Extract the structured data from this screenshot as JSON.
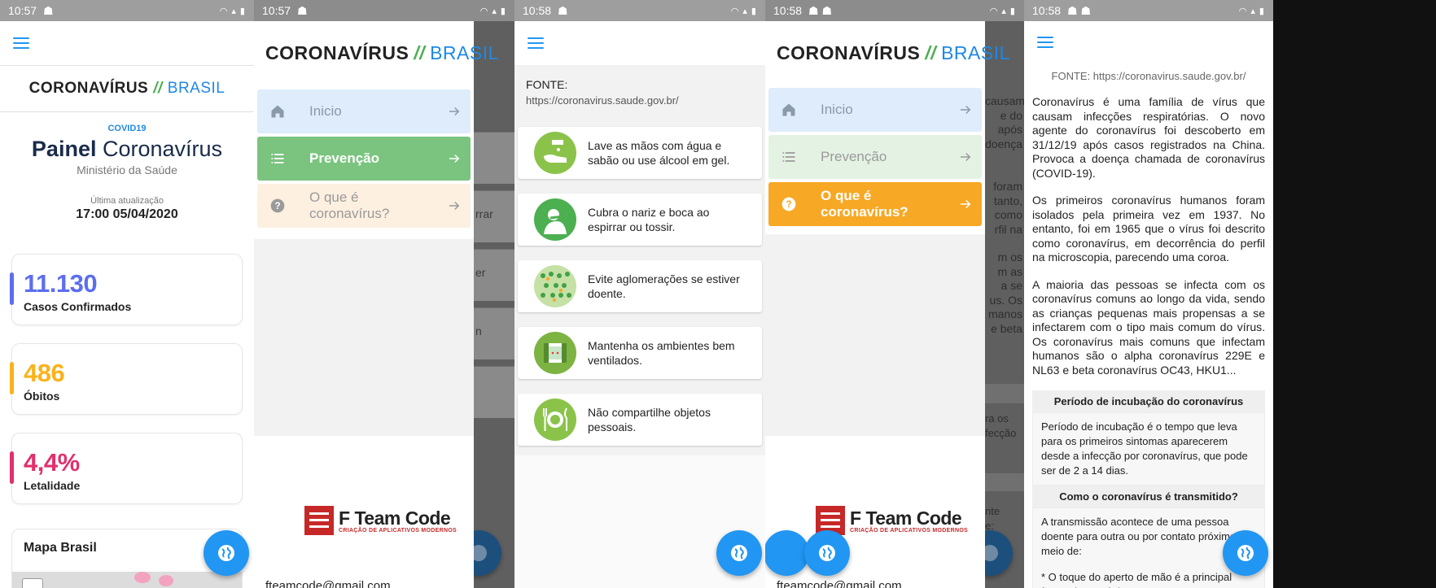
{
  "screen1": {
    "status": {
      "time": "10:57"
    },
    "logo": {
      "left": "CORONAVÍRUS",
      "sep": "//",
      "right": "BRASIL"
    },
    "tag": "COVID19",
    "title_bold": "Painel",
    "title_rest": "Coronavírus",
    "subtitle": "Ministério da Saúde",
    "updated_label": "Última atualização",
    "updated_value": "17:00 05/04/2020",
    "stats": [
      {
        "value": "11.130",
        "label": "Casos Confirmados",
        "color": "#5c6ef0"
      },
      {
        "value": "486",
        "label": "Óbitos",
        "color": "#f9b21c"
      },
      {
        "value": "4,4%",
        "label": "Letalidade",
        "color": "#e2306c"
      }
    ],
    "map_title": "Mapa Brasil"
  },
  "screen2": {
    "status": {
      "time": "10:57"
    },
    "logo": {
      "left": "CORONAVÍRUS",
      "sep": "//",
      "right": "BRASIL"
    },
    "menu": [
      {
        "label": "Inicio",
        "icon": "home-icon"
      },
      {
        "label": "Prevenção",
        "icon": "list-icon"
      },
      {
        "label": "O que é coronavírus?",
        "icon": "help-icon"
      }
    ],
    "brand_big": "F Team Code",
    "brand_small": "CRIAÇÃO DE APLICATIVOS MODERNOS",
    "email": "fteamcode@gmail.com",
    "behind_texts": [
      "rrar",
      "er",
      "n"
    ]
  },
  "screen3": {
    "status": {
      "time": "10:58"
    },
    "fonte_label": "FONTE:",
    "fonte_url": "https://coronavirus.saude.gov.br/",
    "tips": [
      {
        "text": "Lave as mãos com água e sabão ou use álcool em gel.",
        "icon": "hand-wash-icon"
      },
      {
        "text": "Cubra o nariz e boca ao espirrar ou tossir.",
        "icon": "cough-icon"
      },
      {
        "text": "Evite aglomerações se estiver doente.",
        "icon": "crowd-icon"
      },
      {
        "text": "Mantenha os ambientes bem ventilados.",
        "icon": "window-icon"
      },
      {
        "text": "Não compartilhe objetos pessoais.",
        "icon": "plate-icon"
      }
    ]
  },
  "screen4": {
    "status": {
      "time": "10:58"
    },
    "logo": {
      "left": "CORONAVÍRUS",
      "sep": "//",
      "right": "BRASIL"
    },
    "menu": [
      {
        "label": "Inicio",
        "icon": "home-icon"
      },
      {
        "label": "Prevenção",
        "icon": "list-icon"
      },
      {
        "label": "O que é coronavírus?",
        "icon": "help-icon"
      }
    ],
    "brand_big": "F Team Code",
    "brand_small": "CRIAÇÃO DE APLICATIVOS MODERNOS",
    "email": "fteamcode@gmail.com",
    "behind_texts": [
      "causam",
      "e do",
      "após",
      "doença",
      "foram",
      "tanto,",
      "como",
      "rfil na",
      "m os",
      "m as",
      "a se",
      "us. Os",
      "manos",
      "e beta",
      "ra os",
      "fecção",
      "nte",
      "e:"
    ]
  },
  "screen5": {
    "status": {
      "time": "10:58"
    },
    "fonte": "FONTE: https://coronavirus.saude.gov.br/",
    "paragraphs": [
      "Coronavírus é uma família de vírus que causam infecções respiratórias. O novo agente do coronavírus foi descoberto em 31/12/19 após casos registrados na China. Provoca a doença chamada de coronavírus (COVID-19).",
      "Os primeiros coronavírus humanos foram isolados pela primeira vez em 1937. No entanto, foi em 1965 que o vírus foi descrito como coronavírus, em decorrência do perfil na microscopia, parecendo uma coroa.",
      "A maioria das pessoas se infecta com os coronavírus comuns ao longo da vida, sendo as crianças pequenas mais propensas a se infectarem com o tipo mais comum do vírus. Os coronavírus mais comuns que infectam humanos são o alpha coronavírus 229E e NL63 e beta coronavírus OC43, HKU1..."
    ],
    "sections": [
      {
        "title": "Período de incubação do coronavírus",
        "body": "Período de incubação é o tempo que leva para os primeiros sintomas aparecerem desde a infecção por coronavírus, que pode ser de 2 a 14 dias."
      },
      {
        "title": "Como o coronavírus é transmitido?",
        "body": "A transmissão acontece de uma pessoa doente para outra ou por contato próximo por meio de:",
        "body2": "* O toque do aperto de mão é a principal forma de contágio"
      }
    ]
  }
}
